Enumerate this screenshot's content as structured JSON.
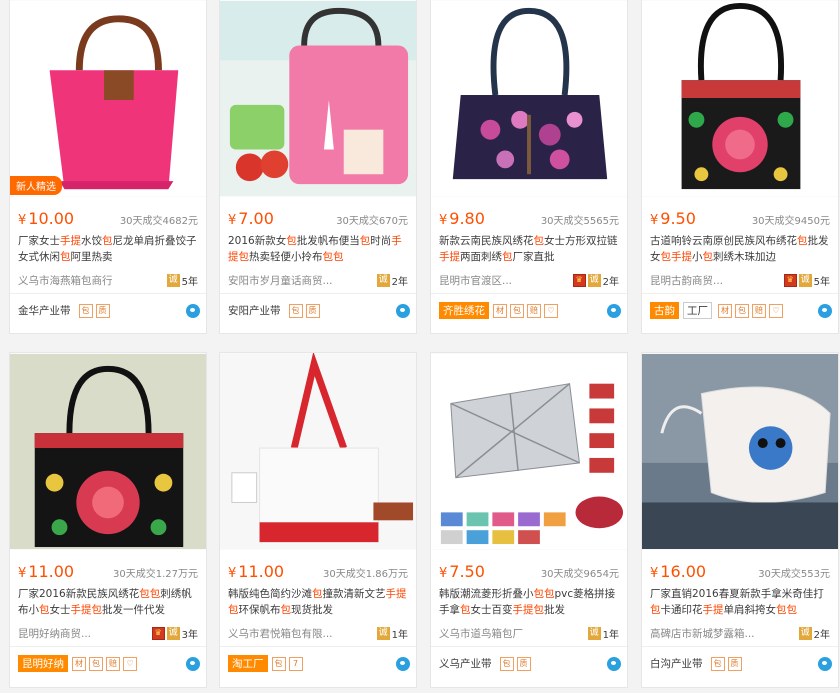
{
  "products": [
    {
      "price": "10.00",
      "sales": "30天成交4682元",
      "title_parts": [
        [
          "厂家女士",
          0
        ],
        [
          "手提",
          1
        ],
        [
          "水饺",
          0
        ],
        [
          "包",
          1
        ],
        [
          "尼龙单肩折叠饺子女式休闲",
          0
        ],
        [
          "包",
          1
        ],
        [
          "阿里热卖",
          0
        ]
      ],
      "shop": "义乌市海燕箱包商行",
      "crown": false,
      "years": "5年",
      "badge_new": "新人精选",
      "belt": "金华产业带",
      "belt_tag": false,
      "icons": [
        "包",
        "质"
      ],
      "photo": "pink-tote"
    },
    {
      "price": "7.00",
      "sales": "30天成交670元",
      "title_parts": [
        [
          "2016新款女",
          0
        ],
        [
          "包",
          1
        ],
        [
          "批发帆布便当",
          0
        ],
        [
          "包",
          1
        ],
        [
          "时尚",
          0
        ],
        [
          "手提",
          1
        ],
        [
          "包",
          1
        ],
        [
          "热卖轻便小拎布",
          0
        ],
        [
          "包",
          1
        ],
        [
          "包",
          1
        ]
      ],
      "shop": "安阳市岁月童话商贸...",
      "crown": false,
      "years": "2年",
      "badge_new": "",
      "belt": "安阳产业带",
      "belt_tag": false,
      "icons": [
        "包",
        "质"
      ],
      "photo": "lunch-bag"
    },
    {
      "price": "9.80",
      "sales": "30天成交5565元",
      "title_parts": [
        [
          "新款云南民族风绣花",
          0
        ],
        [
          "包",
          1
        ],
        [
          "女士方形双拉链",
          0
        ],
        [
          "手提",
          1
        ],
        [
          "两面刺绣",
          0
        ],
        [
          "包",
          1
        ],
        [
          "厂家直批",
          0
        ]
      ],
      "shop": "昆明市官渡区...",
      "crown": true,
      "years": "2年",
      "badge_new": "",
      "belt": "齐胜绣花",
      "belt_tag": true,
      "icons": [
        "材",
        "包",
        "赔",
        "♡"
      ],
      "photo": "embroidered-purple"
    },
    {
      "price": "9.50",
      "sales": "30天成交9450元",
      "title_parts": [
        [
          "古道响铃云南原创民族风布绣花",
          0
        ],
        [
          "包",
          1
        ],
        [
          "批发女",
          0
        ],
        [
          "包",
          1
        ],
        [
          "手提",
          1
        ],
        [
          "小",
          0
        ],
        [
          "包",
          1
        ],
        [
          "刺绣木珠加边",
          0
        ]
      ],
      "shop": "昆明古韵商贸...",
      "crown": true,
      "years": "5年",
      "badge_new": "",
      "belt": "古韵",
      "belt_tag": true,
      "belt_extra": "工厂",
      "icons": [
        "材",
        "包",
        "赔",
        "♡"
      ],
      "photo": "embroidered-black"
    },
    {
      "price": "11.00",
      "sales": "30天成交1.27万元",
      "title_parts": [
        [
          "厂家2016新款民族风绣花",
          0
        ],
        [
          "包",
          1
        ],
        [
          "包",
          1
        ],
        [
          "刺绣帆布小",
          0
        ],
        [
          "包",
          1
        ],
        [
          "女士",
          0
        ],
        [
          "手提",
          1
        ],
        [
          "包",
          1
        ],
        [
          "批发一件代发",
          0
        ]
      ],
      "shop": "昆明好纳商贸...",
      "crown": true,
      "years": "3年",
      "badge_new": "",
      "belt": "昆明好纳",
      "belt_tag": true,
      "icons": [
        "材",
        "包",
        "赔",
        "♡"
      ],
      "photo": "embroidered-red"
    },
    {
      "price": "11.00",
      "sales": "30天成交1.86万元",
      "title_parts": [
        [
          "韩版纯色简约沙滩",
          0
        ],
        [
          "包",
          1
        ],
        [
          "撞款清新文艺",
          0
        ],
        [
          "手提",
          1
        ],
        [
          "包",
          1
        ],
        [
          "环保帆布",
          0
        ],
        [
          "包",
          1
        ],
        [
          "现货批发",
          0
        ]
      ],
      "shop": "义乌市君悦箱包有限...",
      "crown": false,
      "years": "1年",
      "badge_new": "",
      "belt": "淘工厂",
      "belt_tag": true,
      "icons": [
        "包",
        "7"
      ],
      "photo": "canvas-tote"
    },
    {
      "price": "7.50",
      "sales": "30天成交9654元",
      "title_parts": [
        [
          "韩版潮流菱形折叠小",
          0
        ],
        [
          "包",
          1
        ],
        [
          "包",
          1
        ],
        [
          "pvc菱格拼接手拿",
          0
        ],
        [
          "包",
          1
        ],
        [
          "女士百变",
          0
        ],
        [
          "手提",
          1
        ],
        [
          "包",
          1
        ],
        [
          "批发",
          0
        ]
      ],
      "shop": "义乌市道鸟箱包厂",
      "crown": false,
      "years": "1年",
      "badge_new": "",
      "belt": "义乌产业带",
      "belt_tag": false,
      "icons": [
        "包",
        "质"
      ],
      "photo": "geo-bags"
    },
    {
      "price": "16.00",
      "sales": "30天成交553元",
      "title_parts": [
        [
          "厂家直销2016春夏新款手拿米奇佳打",
          0
        ],
        [
          "包",
          1
        ],
        [
          "卡通印花",
          0
        ],
        [
          "手提",
          1
        ],
        [
          "单肩斜挎女",
          0
        ],
        [
          "包",
          1
        ],
        [
          "包",
          1
        ]
      ],
      "shop": "高碑店市新城梦露箱...",
      "crown": false,
      "years": "2年",
      "badge_new": "",
      "belt": "白沟产业带",
      "belt_tag": false,
      "icons": [
        "包",
        "质"
      ],
      "photo": "stitch-bag"
    }
  ],
  "currency": "¥",
  "cheng_icon": "诚"
}
